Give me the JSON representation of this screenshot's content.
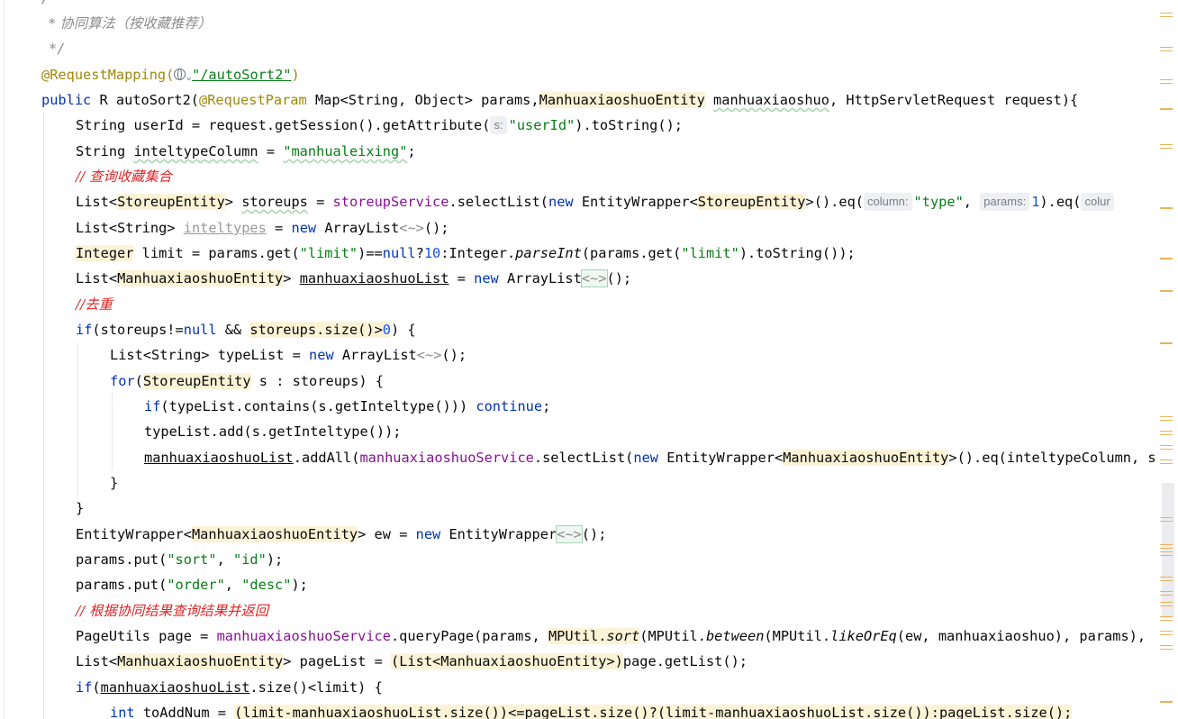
{
  "editor": {
    "lines": {
      "doc_close_top": "/**",
      "doc_comment": "协同算法（按收藏推荐）",
      "doc_end": "*/",
      "mapping_annotation": "@RequestMapping(",
      "mapping_path": "\"/autoSort2\"",
      "mapping_close": ")",
      "sig_public": "public",
      "sig_rest1": " R autoSort2(",
      "sig_reqparam": "@RequestParam",
      "sig_rest2": " Map<String, Object> params,",
      "sig_entity": "ManhuaxiaoshuoEntity",
      "sig_rest3": " ",
      "sig_param": "manhuaxiaoshuo",
      "sig_rest4": ", HttpServletRequest request){",
      "l_userid_1": "String userId = request.getSession().getAttribute(",
      "l_userid_hint": "s:",
      "l_userid_str": "\"userId\"",
      "l_userid_2": ").toString();",
      "l_col_1": "String ",
      "l_col_var": "inteltypeColumn",
      "l_col_2": " = ",
      "l_col_str": "\"manhualeixing\"",
      "l_col_3": ";",
      "c_query": "// 查询收藏集合",
      "l_store_1": "List<",
      "l_store_cls": "StoreupEntity",
      "l_store_2": "> ",
      "l_store_var": "storeups",
      "l_store_3": " = ",
      "l_store_svc": "storeupService",
      "l_store_4": ".selectList(",
      "l_store_new": "new",
      "l_store_5": " EntityWrapper<",
      "l_store_cls2": "StoreupEntity",
      "l_store_6": ">().eq(",
      "l_store_hint1": "column:",
      "l_store_str": "\"type\"",
      "l_store_7": ",",
      "l_store_hint2": "params:",
      "l_store_num": "1",
      "l_store_8": ").eq(",
      "l_store_hint3": "colur",
      "l_types_1": "List<String> ",
      "l_types_var": "inteltypes",
      "l_types_2": " = ",
      "l_types_new": "new",
      "l_types_3": " ArrayList",
      "l_types_dia": "<~>",
      "l_types_4": "();",
      "l_limit_type": "Integer",
      "l_limit_1": " limit = params.get(",
      "l_limit_str1": "\"limit\"",
      "l_limit_2": ")==",
      "l_limit_null": "null",
      "l_limit_3": "?",
      "l_limit_num": "10",
      "l_limit_4": ":Integer.",
      "l_limit_parse": "parseInt",
      "l_limit_5": "(params.get(",
      "l_limit_str2": "\"limit\"",
      "l_limit_6": ").toString());",
      "l_mlist_1": "List<",
      "l_mlist_cls": "ManhuaxiaoshuoEntity",
      "l_mlist_2": "> ",
      "l_mlist_var": "manhuaxiaoshuoList",
      "l_mlist_3": " = ",
      "l_mlist_new": "new",
      "l_mlist_4": " ArrayList",
      "l_mlist_dia": "<~>",
      "l_mlist_5": "();",
      "c_dedup": "//去重",
      "l_if_kw": "if",
      "l_if_1": "(storeups!=",
      "l_if_null": "null",
      "l_if_2": " && ",
      "l_if_hl": "storeups.size()>",
      "l_if_num": "0",
      "l_if_3": ") {",
      "l_tlist_1": "List<String> typeList = ",
      "l_tlist_new": "new",
      "l_tlist_2": " ArrayList",
      "l_tlist_dia": "<~>",
      "l_tlist_3": "();",
      "l_for_kw": "for",
      "l_for_1": "(",
      "l_for_cls": "StoreupEntity",
      "l_for_2": " s : storeups) {",
      "l_if2_kw": "if",
      "l_if2_1": "(typeList.contains(s.getInteltype())) ",
      "l_if2_cont": "continue",
      "l_if2_2": ";",
      "l_add_1": "typeList.add(s.getInteltype());",
      "l_addall_var": "manhuaxiaoshuoList",
      "l_addall_1": ".addAll(",
      "l_addall_svc": "manhuaxiaoshuoService",
      "l_addall_2": ".selectList(",
      "l_addall_new": "new",
      "l_addall_3": " EntityWrapper<",
      "l_addall_cls": "ManhuaxiaoshuoEntity",
      "l_addall_4": ">().eq(inteltypeColumn, s",
      "l_close_inner": "}",
      "l_close_outer": "}",
      "l_ew_1": "EntityWrapper<",
      "l_ew_cls": "ManhuaxiaoshuoEntity",
      "l_ew_2": "> ew = ",
      "l_ew_new": "new",
      "l_ew_3": " EntityWrapper",
      "l_ew_dia": "<~>",
      "l_ew_4": "();",
      "l_sort_1": "params.put(",
      "l_sort_s1": "\"sort\"",
      "l_sort_2": ", ",
      "l_sort_s2": "\"id\"",
      "l_sort_3": ");",
      "l_order_1": "params.put(",
      "l_order_s1": "\"order\"",
      "l_order_2": ", ",
      "l_order_s2": "\"desc\"",
      "l_order_3": ");",
      "c_result": "// 根据协同结果查询结果并返回",
      "l_page_1": "PageUtils page = ",
      "l_page_svc": "manhuaxiaoshuoService",
      "l_page_2": ".queryPage(params, ",
      "l_page_mp": "MPUtil.",
      "l_page_sort": "sort",
      "l_page_3": "(MPUtil.",
      "l_page_between": "between",
      "l_page_4": "(MPUtil.",
      "l_page_like": "likeOrEq",
      "l_page_5": "(ew, manhuaxiaoshuo), params),",
      "l_plist_1": "List<",
      "l_plist_cls": "ManhuaxiaoshuoEntity",
      "l_plist_2": "> pageList = ",
      "l_plist_hl": "(List<ManhuaxiaoshuoEntity>)",
      "l_plist_3": "page.getList();",
      "l_if3_kw": "if",
      "l_if3_1": "(",
      "l_if3_var": "manhuaxiaoshuoList",
      "l_if3_2": ".size()<limit) {",
      "l_int_kw": "int",
      "l_int_1": " toAddNum = ",
      "l_int_hl": "(limit-manhuaxiaoshuoList.size())<=pageList.size()?(limit-manhuaxiaoshuoList.size()):pageList.size();"
    }
  }
}
